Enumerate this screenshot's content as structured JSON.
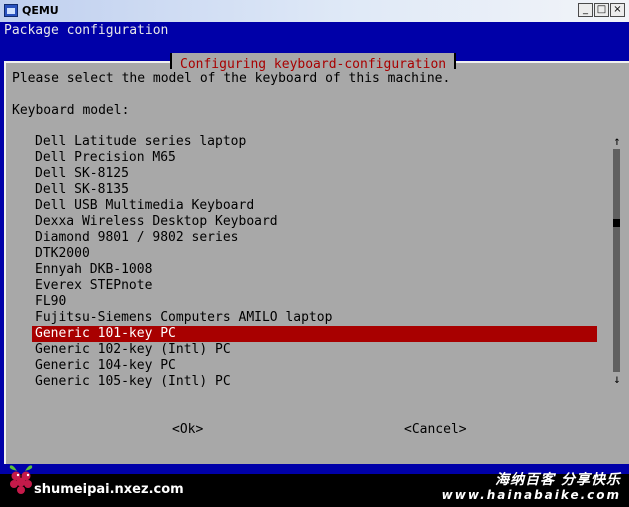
{
  "window": {
    "title": "QEMU",
    "minimize": "_",
    "maximize": "□",
    "close": "×"
  },
  "screen": {
    "header": "Package configuration",
    "dialog": {
      "title": "Configuring keyboard-configuration",
      "prompt": "Please select the model of the keyboard of this machine.",
      "label": "Keyboard model:",
      "items": [
        "Dell Latitude series laptop",
        "Dell Precision M65",
        "Dell SK-8125",
        "Dell SK-8135",
        "Dell USB Multimedia Keyboard",
        "Dexxa Wireless Desktop Keyboard",
        "Diamond 9801 / 9802 series",
        "DTK2000",
        "Ennyah DKB-1008",
        "Everex STEPnote",
        "FL90",
        "Fujitsu-Siemens Computers AMILO laptop",
        "Generic 101-key PC",
        "Generic 102-key (Intl) PC",
        "Generic 104-key PC",
        "Generic 105-key (Intl) PC"
      ],
      "selected_index": 12,
      "scroll_up": "↑",
      "scroll_down": "↓",
      "ok_label": "<Ok>",
      "cancel_label": "<Cancel>"
    }
  },
  "watermark": {
    "left_site": "shumeipai.nxez.com",
    "right_cn": "海纳百客 分享快乐",
    "right_url": "www.hainabaike.com"
  },
  "colors": {
    "screen_bg": "#0000a8",
    "dialog_bg": "#a8a8a8",
    "highlight": "#a80000"
  }
}
